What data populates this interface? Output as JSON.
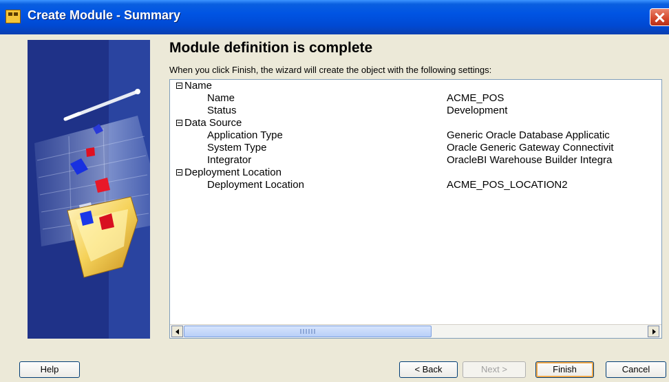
{
  "window": {
    "title": "Create Module - Summary"
  },
  "main": {
    "heading": "Module definition is complete",
    "description": "When you click Finish, the wizard will create the object with the following settings:",
    "groups": [
      {
        "label": "Name",
        "properties": [
          {
            "label": "Name",
            "value": "ACME_POS"
          },
          {
            "label": "Status",
            "value": "Development"
          }
        ]
      },
      {
        "label": "Data Source",
        "properties": [
          {
            "label": "Application Type",
            "value": "Generic Oracle Database Applicatic"
          },
          {
            "label": "System Type",
            "value": "Oracle Generic Gateway Connectivit"
          },
          {
            "label": "Integrator",
            "value": "OracleBI Warehouse Builder Integra"
          }
        ]
      },
      {
        "label": "Deployment Location",
        "properties": [
          {
            "label": "Deployment Location",
            "value": "ACME_POS_LOCATION2"
          }
        ]
      }
    ]
  },
  "footer": {
    "help_label": "Help",
    "back_label": "< Back",
    "next_label": "Next >",
    "finish_label": "Finish",
    "cancel_label": "Cancel"
  },
  "icons": {
    "app": "wizard-app-icon",
    "close": "close-icon",
    "tree_toggle": "collapse-minus-icon",
    "scroll_left": "scroll-left-arrow-icon",
    "scroll_right": "scroll-right-arrow-icon"
  },
  "colors": {
    "titlebar": "#0054e3",
    "dialog_bg": "#ece9d8",
    "panel_border": "#7f9db9",
    "default_button_highlight": "#f2a94a"
  }
}
